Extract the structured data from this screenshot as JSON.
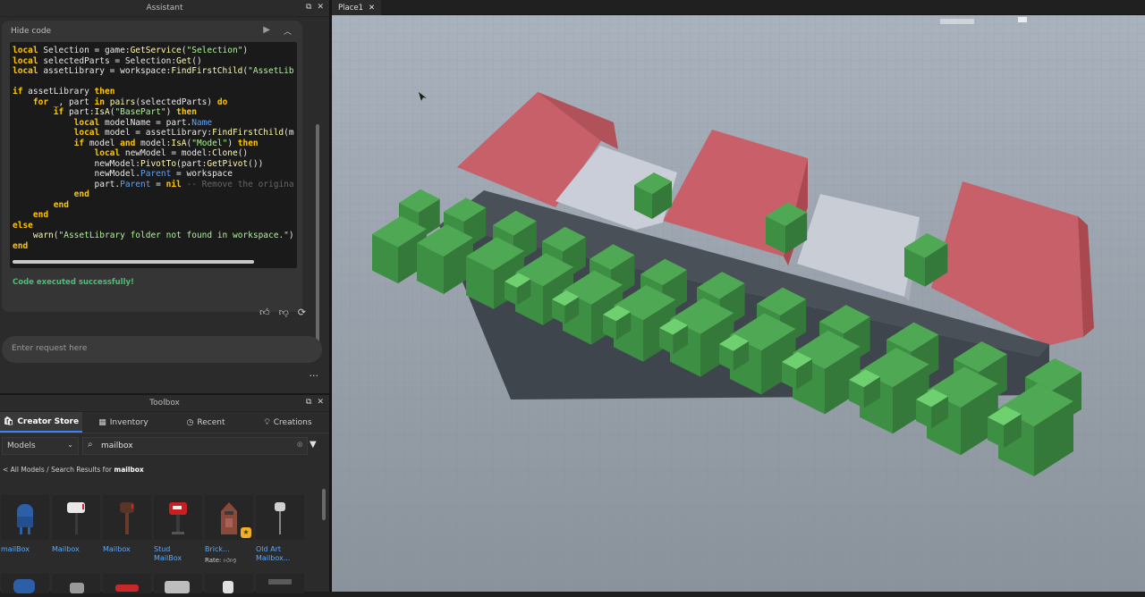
{
  "assistant": {
    "title": "Assistant",
    "hide_code": "Hide code",
    "code_lines": [
      [
        [
          "kw",
          "local "
        ],
        [
          "t",
          "Selection = game:"
        ],
        [
          "fn",
          "GetService"
        ],
        [
          "t",
          "("
        ],
        [
          "str",
          "\"Selection\""
        ],
        [
          "t",
          ")"
        ]
      ],
      [
        [
          "kw",
          "local "
        ],
        [
          "t",
          "selectedParts = Selection:"
        ],
        [
          "fn",
          "Get"
        ],
        [
          "t",
          "()"
        ]
      ],
      [
        [
          "kw",
          "local "
        ],
        [
          "t",
          "assetLibrary = workspace:"
        ],
        [
          "fn",
          "FindFirstChild"
        ],
        [
          "t",
          "("
        ],
        [
          "str",
          "\"AssetLib"
        ]
      ],
      [],
      [
        [
          "kw",
          "if "
        ],
        [
          "t",
          "assetLibrary "
        ],
        [
          "kw",
          "then"
        ]
      ],
      [
        [
          "t",
          "    "
        ],
        [
          "kw",
          "for "
        ],
        [
          "t",
          "_, part "
        ],
        [
          "kw",
          "in "
        ],
        [
          "fn",
          "pairs"
        ],
        [
          "t",
          "(selectedParts) "
        ],
        [
          "kw",
          "do"
        ]
      ],
      [
        [
          "t",
          "        "
        ],
        [
          "kw",
          "if "
        ],
        [
          "t",
          "part:"
        ],
        [
          "fn",
          "IsA"
        ],
        [
          "t",
          "("
        ],
        [
          "str",
          "\"BasePart\""
        ],
        [
          "t",
          ") "
        ],
        [
          "kw",
          "then"
        ]
      ],
      [
        [
          "t",
          "            "
        ],
        [
          "kw",
          "local "
        ],
        [
          "t",
          "modelName = part."
        ],
        [
          "prop",
          "Name"
        ]
      ],
      [
        [
          "t",
          "            "
        ],
        [
          "kw",
          "local "
        ],
        [
          "t",
          "model = assetLibrary:"
        ],
        [
          "fn",
          "FindFirstChild"
        ],
        [
          "t",
          "(m"
        ]
      ],
      [
        [
          "t",
          "            "
        ],
        [
          "kw",
          "if "
        ],
        [
          "t",
          "model "
        ],
        [
          "kw",
          "and "
        ],
        [
          "t",
          "model:"
        ],
        [
          "fn",
          "IsA"
        ],
        [
          "t",
          "("
        ],
        [
          "str",
          "\"Model\""
        ],
        [
          "t",
          ") "
        ],
        [
          "kw",
          "then"
        ]
      ],
      [
        [
          "t",
          "                "
        ],
        [
          "kw",
          "local "
        ],
        [
          "t",
          "newModel = model:"
        ],
        [
          "fn",
          "Clone"
        ],
        [
          "t",
          "()"
        ]
      ],
      [
        [
          "t",
          "                newModel:"
        ],
        [
          "fn",
          "PivotTo"
        ],
        [
          "t",
          "(part:"
        ],
        [
          "fn",
          "GetPivot"
        ],
        [
          "t",
          "())"
        ]
      ],
      [
        [
          "t",
          "                newModel."
        ],
        [
          "prop",
          "Parent"
        ],
        [
          "t",
          " = workspace"
        ]
      ],
      [
        [
          "t",
          "                part."
        ],
        [
          "prop",
          "Parent"
        ],
        [
          "t",
          " = "
        ],
        [
          "kw",
          "nil "
        ],
        [
          "cm",
          "-- Remove the origina"
        ]
      ],
      [
        [
          "t",
          "            "
        ],
        [
          "kw",
          "end"
        ]
      ],
      [
        [
          "t",
          "        "
        ],
        [
          "kw",
          "end"
        ]
      ],
      [
        [
          "t",
          "    "
        ],
        [
          "kw",
          "end"
        ]
      ],
      [
        [
          "kw",
          "else"
        ]
      ],
      [
        [
          "t",
          "    "
        ],
        [
          "fn",
          "warn"
        ],
        [
          "t",
          "("
        ],
        [
          "str",
          "\"AssetLibrary folder not found in workspace.\""
        ],
        [
          "t",
          ")"
        ]
      ],
      [
        [
          "kw",
          "end"
        ]
      ]
    ],
    "status": "Code executed successfully!",
    "request_placeholder": "Enter request here",
    "more": "..."
  },
  "toolbox": {
    "title": "Toolbox",
    "tabs": [
      "Creator Store",
      "Inventory",
      "Recent",
      "Creations"
    ],
    "category": "Models",
    "search_value": "mailbox",
    "breadcrumb_prefix": "< All Models / Search Results for ",
    "breadcrumb_query": "mailbox",
    "items": [
      {
        "name": "mailBox",
        "name2": ""
      },
      {
        "name": "Mailbox",
        "name2": ""
      },
      {
        "name": "Mailbox",
        "name2": ""
      },
      {
        "name": "Stud",
        "name2": "MailBox"
      },
      {
        "name": "Brick...",
        "name2": ""
      },
      {
        "name": "Old Art",
        "name2": "Mailbox..."
      }
    ],
    "rate_label": "Rate:"
  },
  "document": {
    "tab": "Place1"
  },
  "colors": {
    "accent": "#3b82f6",
    "success": "#47c272",
    "link": "#5aa8ff",
    "shrub_green": "#3f8f45",
    "block_red": "#c76069",
    "block_white": "#c9ced8",
    "wall": "#444b53",
    "baseplate": "#8b939c"
  }
}
